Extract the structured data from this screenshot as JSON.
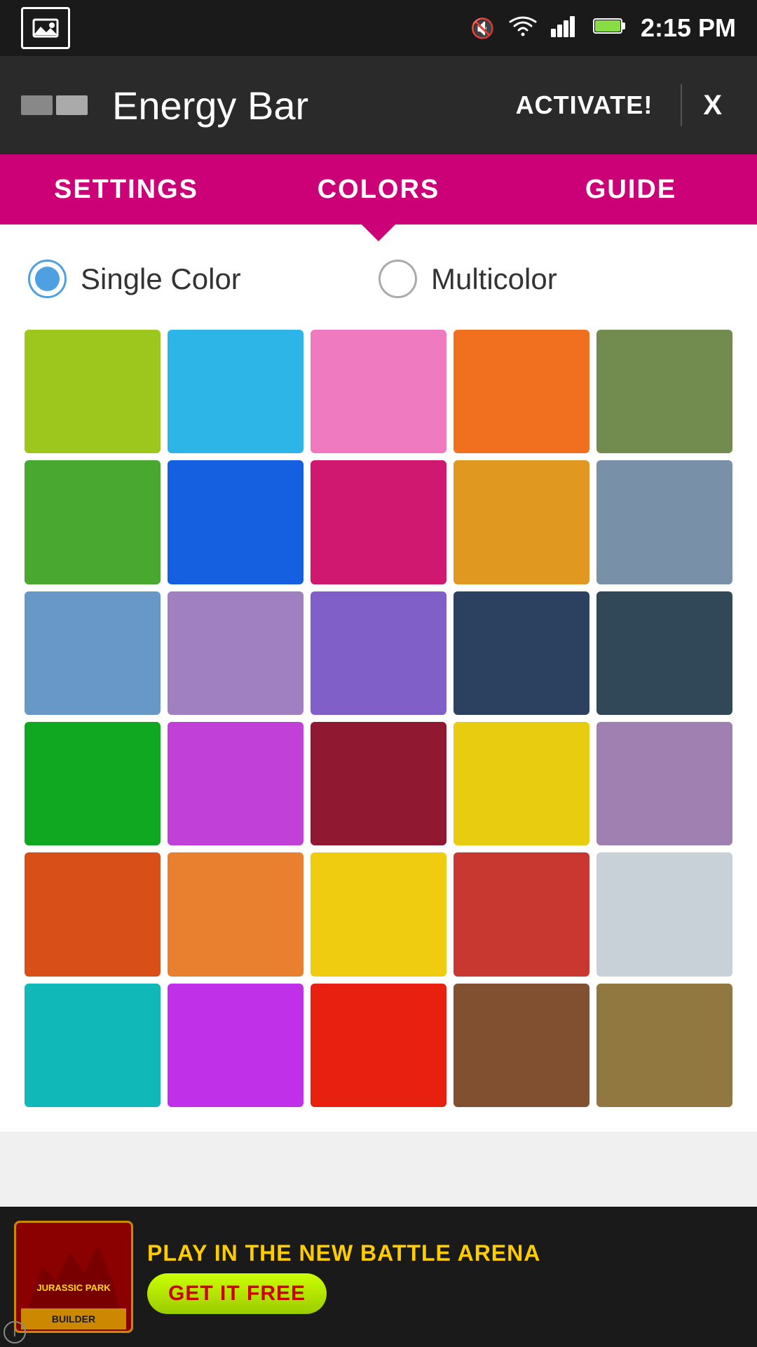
{
  "statusBar": {
    "time": "2:15 PM",
    "icons": [
      "mute",
      "wifi",
      "signal",
      "battery"
    ]
  },
  "titleBar": {
    "title": "Energy Bar",
    "activateLabel": "ACTIVATE!",
    "closeLabel": "X"
  },
  "tabs": [
    {
      "id": "settings",
      "label": "SETTINGS",
      "active": false
    },
    {
      "id": "colors",
      "label": "COLORS",
      "active": true
    },
    {
      "id": "guide",
      "label": "GUIDE",
      "active": false
    }
  ],
  "colorOptions": {
    "singleColor": {
      "label": "Single Color",
      "selected": true
    },
    "multicolor": {
      "label": "Multicolor",
      "selected": false
    }
  },
  "colors": [
    "#9dc71c",
    "#2db5e8",
    "#f07ac0",
    "#f07020",
    "#728c50",
    "#48a830",
    "#1560e0",
    "#d01870",
    "#e09820",
    "#7890a8",
    "#6898c8",
    "#a080c0",
    "#8060c8",
    "#2c4060",
    "#304858",
    "#10a820",
    "#c040d8",
    "#901830",
    "#e8cc10",
    "#a080b0",
    "#d85018",
    "#e88030",
    "#f0cc10",
    "#c83830",
    "#c8d0d8",
    "#10b8b8",
    "#c030e8",
    "#e82010",
    "#805030",
    "#907840"
  ],
  "adBanner": {
    "topText": "PLAY IN THE NEW",
    "highlightText": "BATTLE ARENA",
    "buttonLabel": "GET IT FREE",
    "brandName": "JURASSIC PARK",
    "brandSub": "BUILDER"
  }
}
